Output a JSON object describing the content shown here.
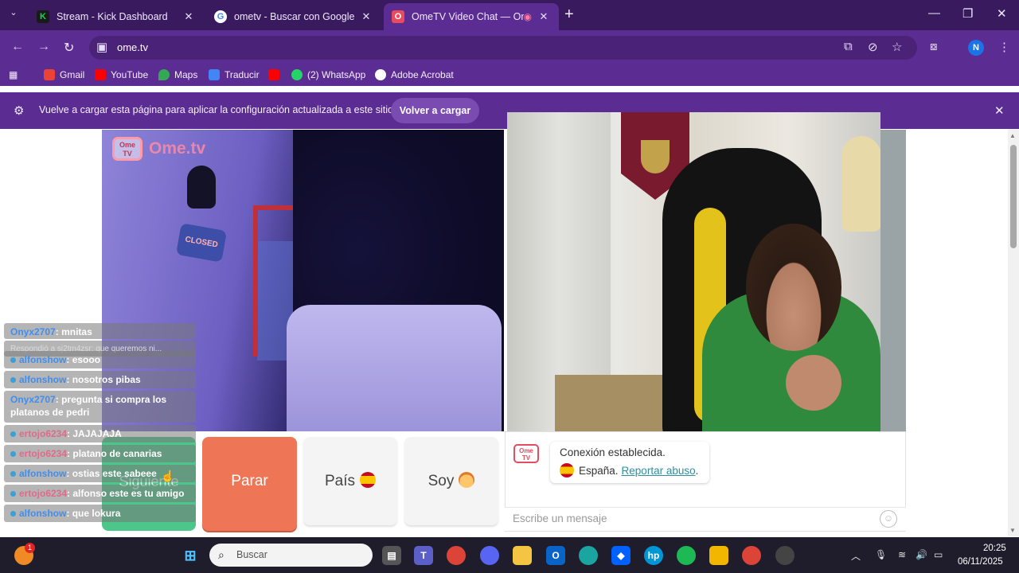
{
  "browser": {
    "tabs": [
      {
        "title": "Stream - Kick Dashboard",
        "favicon": "K",
        "favicon_color": "#1dd15a"
      },
      {
        "title": "ometv - Buscar con Google",
        "favicon": "G",
        "favicon_color": "#ffffff"
      },
      {
        "title": "OmeTV Video Chat — Ome",
        "favicon": "O",
        "favicon_color": "#e94a5e"
      }
    ],
    "url": "ome.tv",
    "profile_initial": "N",
    "bookmarks": [
      "Gmail",
      "YouTube",
      "Maps",
      "Traducir",
      "(2) WhatsApp",
      "Adobe Acrobat"
    ],
    "infobar": {
      "text": "Vuelve a cargar esta página para aplicar la configuración actualizada a este sitio",
      "button": "Volver a cargar"
    }
  },
  "ometv": {
    "logo_tv": "Ome TV",
    "logo_name": "Ome.tv",
    "sign_text": "CLOSED",
    "chat_messages": [
      {
        "user": "Onyx2707",
        "text": "mnitas",
        "user_color": "blue"
      },
      {
        "user": "",
        "text": "Respondió a sj2tm4zsr: que queremos ni...",
        "user_color": "blue"
      },
      {
        "user": "alfonshow",
        "text": "esooo",
        "user_color": "blue"
      },
      {
        "user": "alfonshow",
        "text": "nosotros pibas",
        "user_color": "blue"
      },
      {
        "user": "Onyx2707",
        "text": "pregunta si compra los platanos de pedri",
        "user_color": "blue"
      },
      {
        "user": "ertojo6234",
        "text": "JAJAJAJA",
        "user_color": "pink"
      },
      {
        "user": "ertojo6234",
        "text": "platano de canarias",
        "user_color": "pink"
      },
      {
        "user": "alfonshow",
        "text": "ostias este sabeee",
        "user_color": "blue"
      },
      {
        "user": "ertojo6234",
        "text": "alfonso este es tu amigo",
        "user_color": "pink"
      },
      {
        "user": "alfonshow",
        "text": "que lokura",
        "user_color": "blue"
      }
    ],
    "buttons": {
      "next": "Siguiente",
      "stop": "Parar",
      "country": "País",
      "gender": "Soy"
    },
    "system_message": {
      "line1": "Conexión establecida.",
      "country": "España.",
      "report": "Reportar abuso",
      "suffix": "."
    },
    "message_placeholder": "Escribe un mensaje",
    "colors": {
      "next": "#4cc68a",
      "stop": "#ef7557"
    }
  },
  "taskbar": {
    "search_placeholder": "Buscar",
    "time": "20:25",
    "date": "06/11/2025",
    "notification_count": "1"
  }
}
